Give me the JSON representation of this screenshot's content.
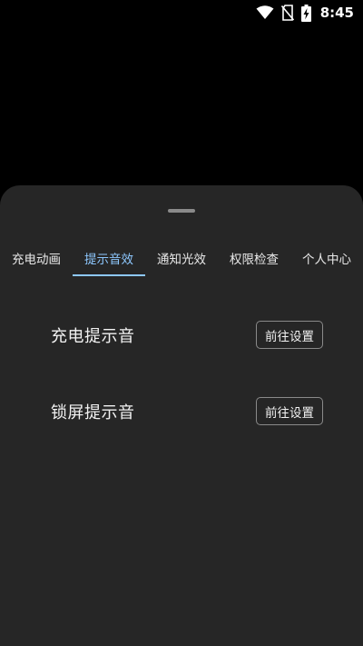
{
  "status_bar": {
    "time": "8:45",
    "icons": [
      "wifi-icon",
      "no-sim-icon",
      "battery-charging-icon"
    ]
  },
  "tabs": [
    {
      "label": "充电动画",
      "active": false
    },
    {
      "label": "提示音效",
      "active": true
    },
    {
      "label": "通知光效",
      "active": false
    },
    {
      "label": "权限检查",
      "active": false
    },
    {
      "label": "个人中心",
      "active": false
    }
  ],
  "settings": [
    {
      "label": "充电提示音",
      "button": "前往设置"
    },
    {
      "label": "锁屏提示音",
      "button": "前往设置"
    }
  ],
  "colors": {
    "background": "#000000",
    "sheet": "#262626",
    "accent": "#8ec8ff",
    "text": "#f2f2f2"
  }
}
